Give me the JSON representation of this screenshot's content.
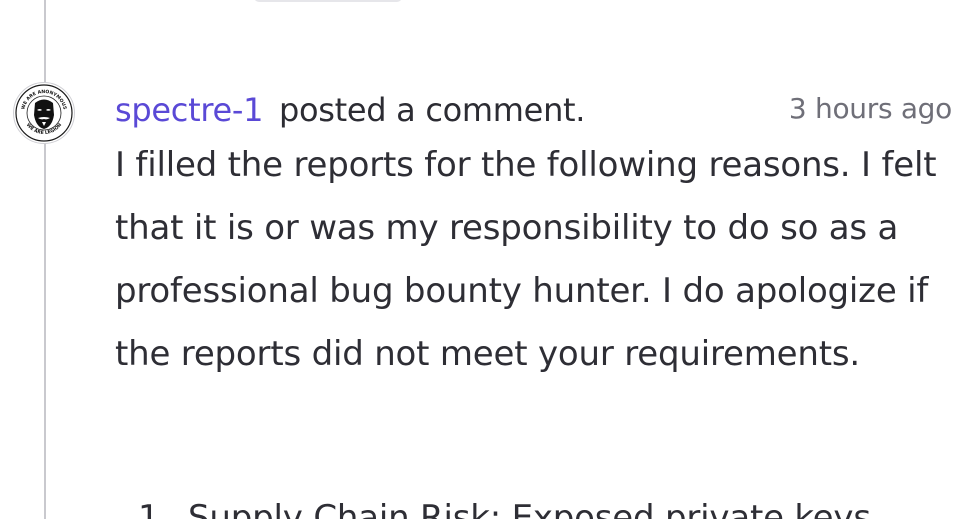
{
  "comment": {
    "author": "spectre-1",
    "action": "posted a comment.",
    "timestamp": "3 hours ago",
    "body": "I filled the reports for the following reasons. I felt that it is or was my responsibility to do so as a professional bug bounty hunter. I do apologize if the reports did not meet your requirements.",
    "list": [
      {
        "number": "1.",
        "text": "Supply Chain Risk: Exposed private keys"
      }
    ]
  },
  "avatar": {
    "icon": "anonymous-mask-avatar-icon",
    "ring_text_top": "WE ARE ANONYMOUS",
    "ring_text_bottom": "WE ARE LEGION"
  },
  "colors": {
    "author_link": "#5a49d6",
    "body_text": "#2e2e35",
    "timestamp": "#6f6f78",
    "timeline_line": "#c9c9ce"
  }
}
